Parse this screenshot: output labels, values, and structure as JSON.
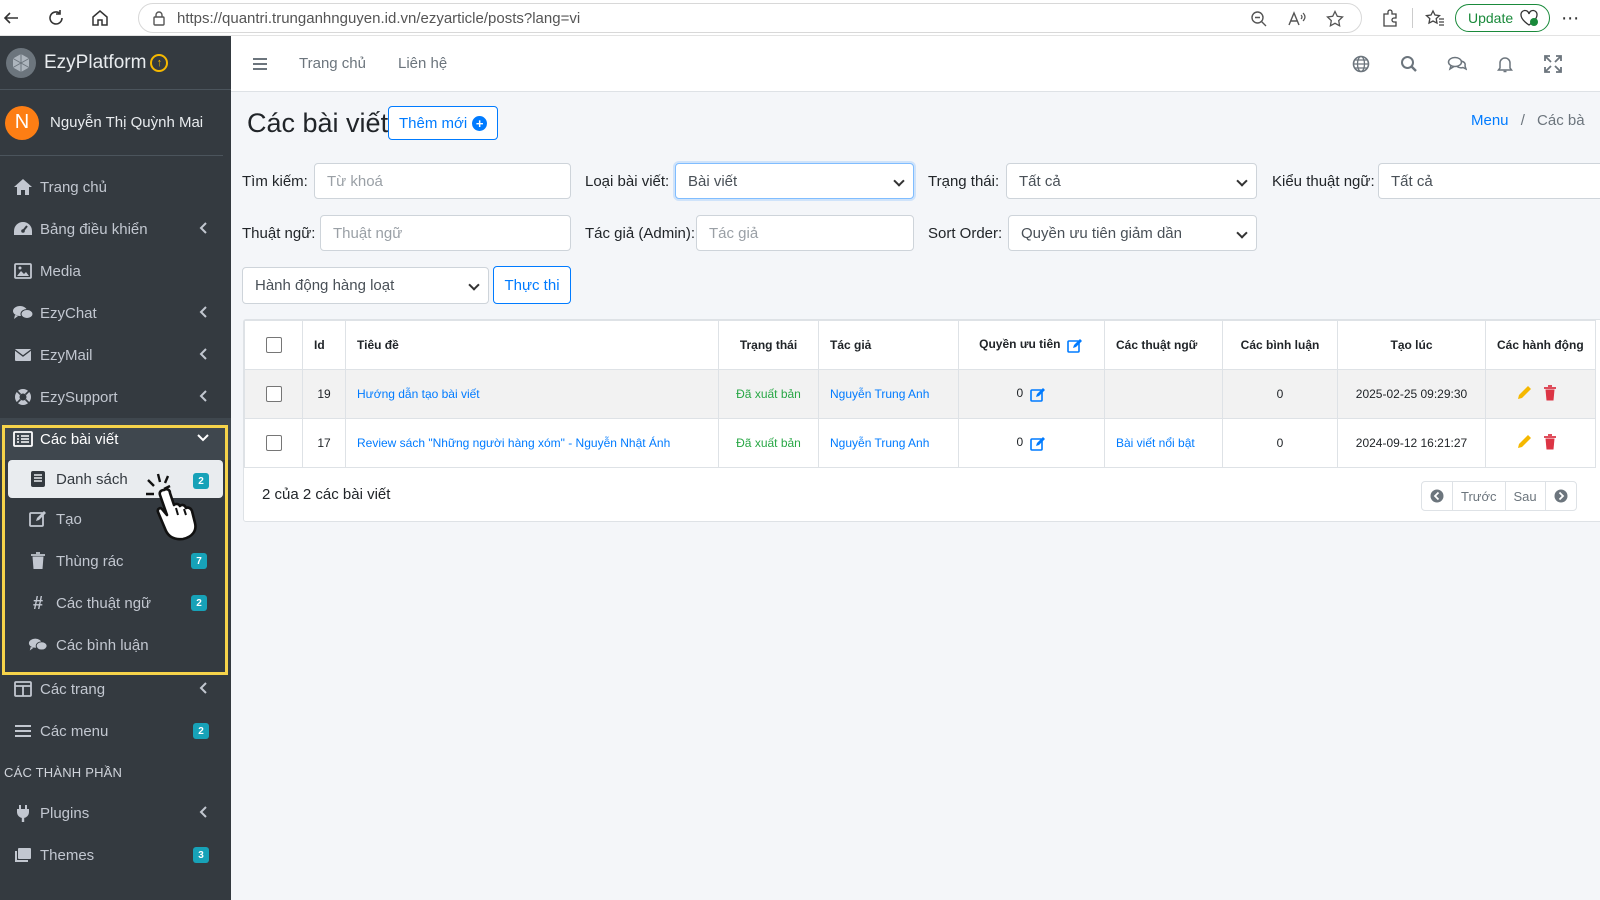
{
  "browser": {
    "url": "https://quantri.trunganhnguyen.id.vn/ezyarticle/posts?lang=vi",
    "update_label": "Update"
  },
  "sidebar": {
    "brand": "EzyPlatform",
    "user_initial": "N",
    "user_name": "Nguyễn Thị Quỳnh Mai",
    "items": [
      {
        "label": "Trang chủ",
        "icon": "home-icon"
      },
      {
        "label": "Bảng điều khiển",
        "icon": "dashboard-icon"
      },
      {
        "label": "Media",
        "icon": "image-icon"
      },
      {
        "label": "EzyChat",
        "icon": "chat-icon"
      },
      {
        "label": "EzyMail",
        "icon": "mail-icon"
      },
      {
        "label": "EzySupport",
        "icon": "support-icon"
      },
      {
        "label": "Các bài viết",
        "icon": "list-icon"
      }
    ],
    "sub_items": [
      {
        "label": "Danh sách",
        "badge": "2"
      },
      {
        "label": "Tạo",
        "badge": ""
      },
      {
        "label": "Thùng rác",
        "badge": "7"
      },
      {
        "label": "Các thuật ngữ",
        "badge": "2"
      },
      {
        "label": "Các bình luận",
        "badge": ""
      }
    ],
    "after_items": [
      {
        "label": "Các trang"
      },
      {
        "label": "Các menu",
        "badge": "2"
      }
    ],
    "section_header": "CÁC THÀNH PHẦN",
    "component_items": [
      {
        "label": "Plugins"
      },
      {
        "label": "Themes",
        "badge": "3"
      }
    ]
  },
  "topbar": {
    "links": [
      "Trang chủ",
      "Liên hệ"
    ]
  },
  "page": {
    "title": "Các bài viết",
    "add_label": "Thêm mới",
    "breadcrumb_root": "Menu",
    "breadcrumb_sep": "/",
    "breadcrumb_current": "Các bà"
  },
  "filters": {
    "search_label": "Tìm kiếm:",
    "search_placeholder": "Từ khoá",
    "type_label": "Loại bài viết:",
    "type_value": "Bài viết",
    "status_label": "Trạng thái:",
    "status_value": "Tất cả",
    "term_type_label": "Kiểu thuật ngữ:",
    "term_type_value": "Tất cả",
    "term_label": "Thuật ngữ:",
    "term_placeholder": "Thuật ngữ",
    "author_label": "Tác giả (Admin):",
    "author_placeholder": "Tác giả",
    "sort_label": "Sort Order:",
    "sort_value": "Quyền ưu tiên giảm dần",
    "bulk_value": "Hành động hàng loạt",
    "exec_label": "Thực thi"
  },
  "table": {
    "headers": {
      "id": "Id",
      "title": "Tiêu đề",
      "status": "Trạng thái",
      "author": "Tác giả",
      "priority": "Quyền ưu tiên",
      "terms": "Các thuật ngữ",
      "comments": "Các bình luận",
      "created": "Tạo lúc",
      "actions": "Các hành động"
    },
    "rows": [
      {
        "id": "19",
        "title": "Hướng dẫn tạo bài viết",
        "status": "Đã xuất bản",
        "author": "Nguyễn Trung Anh",
        "priority": "0",
        "terms": "",
        "comments": "0",
        "created": "2025-02-25 09:29:30"
      },
      {
        "id": "17",
        "title": "Review sách \"Những người hàng xóm\" - Nguyễn Nhật Ánh",
        "status": "Đã xuất bản",
        "author": "Nguyễn Trung Anh",
        "priority": "0",
        "terms": "Bài viết nổi bật",
        "comments": "0",
        "created": "2024-09-12 16:21:27"
      }
    ],
    "summary": "2 của 2 các bài viết",
    "prev_label": "Trước",
    "next_label": "Sau"
  },
  "colors": {
    "accent": "#007bff",
    "sidebar_bg": "#343a40",
    "highlight": "#f6d34a",
    "published": "#28a745",
    "edit": "#f5b800",
    "delete": "#dc3545"
  }
}
